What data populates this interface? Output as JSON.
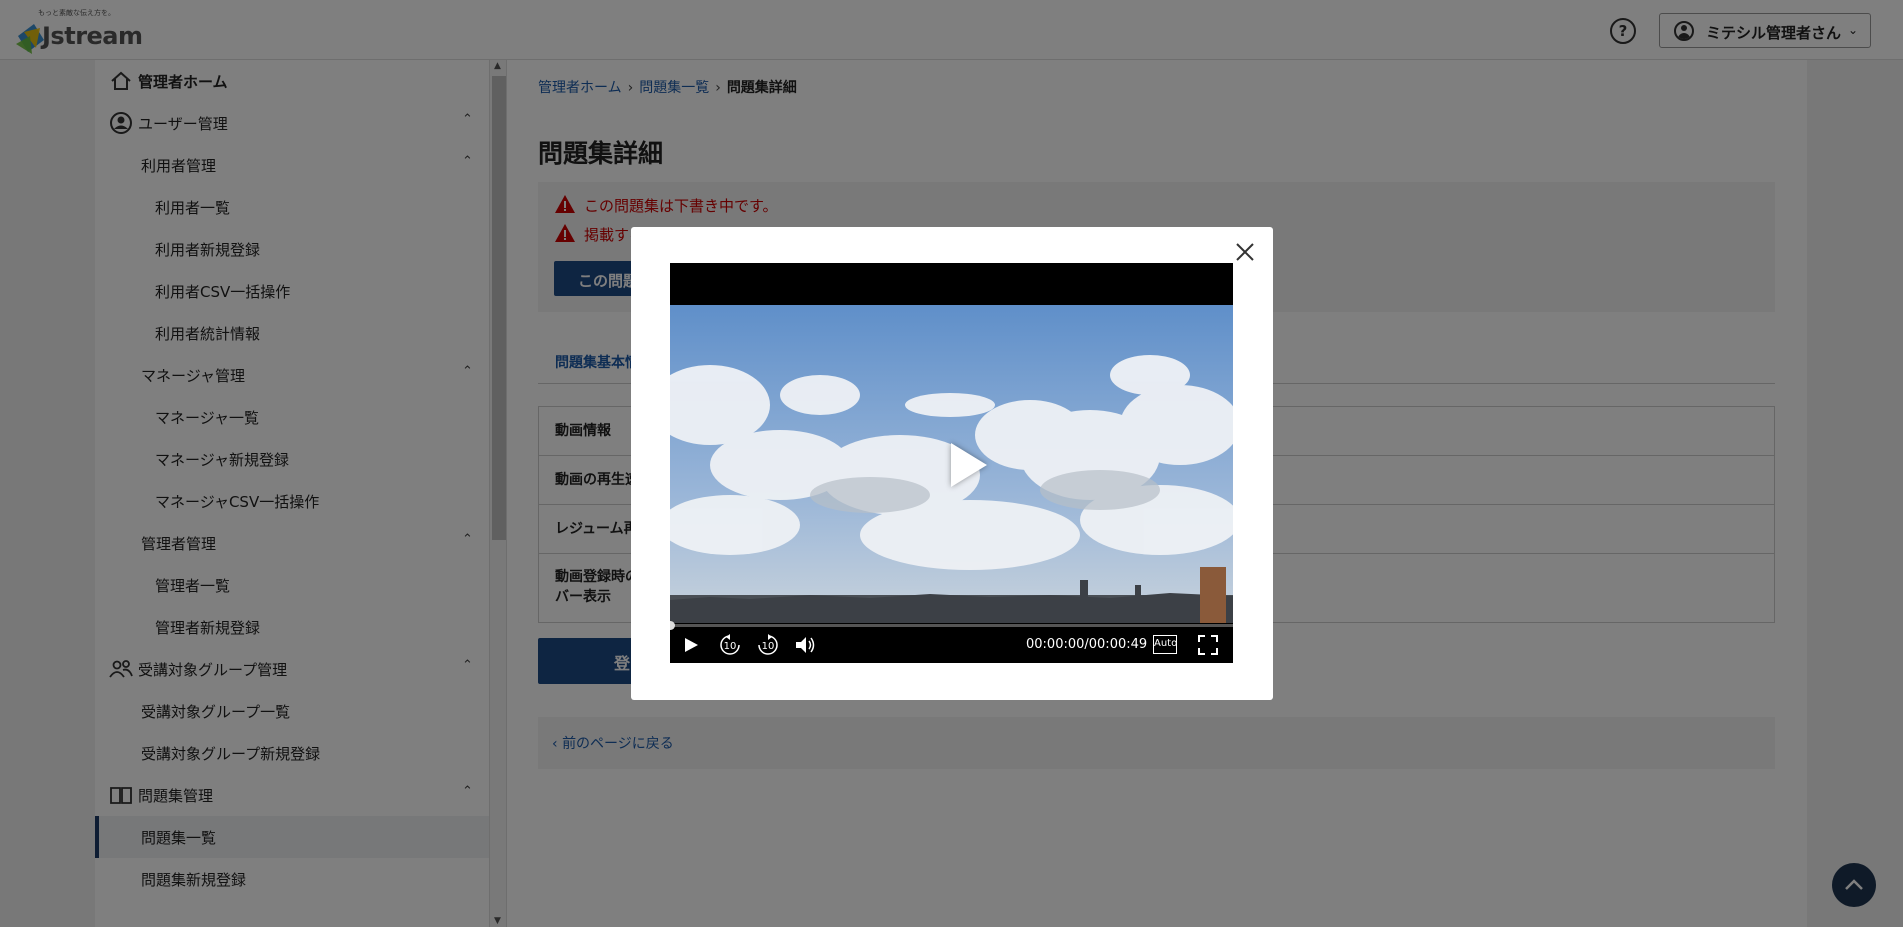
{
  "header": {
    "logo_tagline": "もっと素敵な伝え方を。",
    "logo_text": "Jstream",
    "help_icon": "question-circle-icon",
    "user_label": "ミテシル管理者さん"
  },
  "sidebar": {
    "items": [
      {
        "label": "管理者ホーム",
        "level": 0,
        "icon": "home-icon"
      },
      {
        "label": "ユーザー管理",
        "level": 0,
        "icon": "user-circle-icon",
        "expanded": true
      },
      {
        "label": "利用者管理",
        "level": 1,
        "expanded": true
      },
      {
        "label": "利用者一覧",
        "level": 2
      },
      {
        "label": "利用者新規登録",
        "level": 2
      },
      {
        "label": "利用者CSV一括操作",
        "level": 2
      },
      {
        "label": "利用者統計情報",
        "level": 2
      },
      {
        "label": "マネージャ管理",
        "level": 1,
        "expanded": true
      },
      {
        "label": "マネージャ一覧",
        "level": 2
      },
      {
        "label": "マネージャ新規登録",
        "level": 2
      },
      {
        "label": "マネージャCSV一括操作",
        "level": 2
      },
      {
        "label": "管理者管理",
        "level": 1,
        "expanded": true
      },
      {
        "label": "管理者一覧",
        "level": 2
      },
      {
        "label": "管理者新規登録",
        "level": 2
      },
      {
        "label": "受講対象グループ管理",
        "level": 0,
        "icon": "group-icon",
        "expanded": true
      },
      {
        "label": "受講対象グループ一覧",
        "level": 1
      },
      {
        "label": "受講対象グループ新規登録",
        "level": 1
      },
      {
        "label": "問題集管理",
        "level": 0,
        "icon": "book-icon",
        "expanded": true
      },
      {
        "label": "問題集一覧",
        "level": 1,
        "active": true
      },
      {
        "label": "問題集新規登録",
        "level": 1
      }
    ]
  },
  "breadcrumb": {
    "home": "管理者ホーム",
    "list": "問題集一覧",
    "current": "問題集詳細"
  },
  "main": {
    "title": "問題集詳細",
    "alert_1": "この問題集は下書き中です。",
    "alert_2": "掲載する",
    "draft_button": "この問題",
    "tab": "問題集基本情",
    "rows": [
      "動画情報",
      "動画の再生速",
      "レジューム再",
      "動画登録時の\nバー表示"
    ],
    "submit_button": "登",
    "back_link": "前のページに戻る"
  },
  "modal": {
    "close_icon": "close-icon",
    "time": "00:00:00/00:00:49",
    "quality": "Auto",
    "rewind_seconds": "10",
    "forward_seconds": "10",
    "progress": 0
  },
  "colors": {
    "primary": "#1d4a85",
    "link": "#1d5aa8",
    "alert": "#cc0000",
    "overlay": "rgba(0,0,0,0.5)"
  }
}
